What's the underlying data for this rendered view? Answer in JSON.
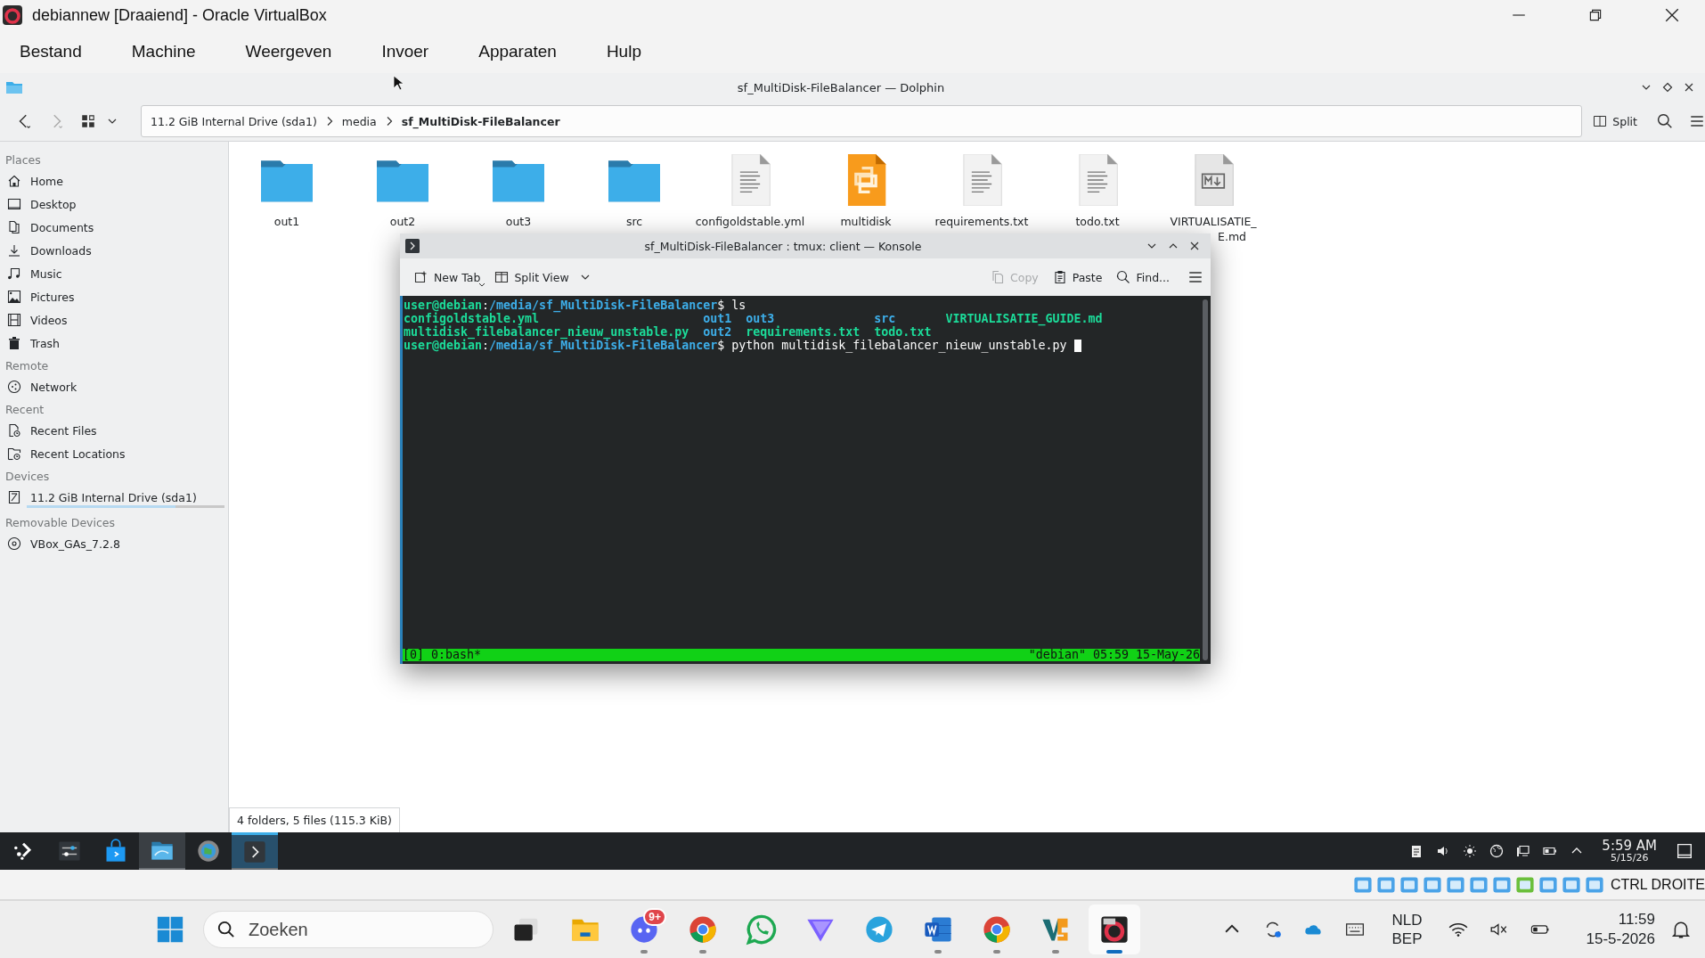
{
  "vbox": {
    "title": "debiannew [Draaiend] - Oracle VirtualBox",
    "menu": [
      "Bestand",
      "Machine",
      "Weergeven",
      "Invoer",
      "Apparaten",
      "Hulp"
    ],
    "host_key": "CTRL DROITE"
  },
  "dolphin": {
    "title": "sf_MultiDisk-FileBalancer — Dolphin",
    "breadcrumb": [
      {
        "label": "11.2 GiB Internal Drive (sda1)",
        "selected": false
      },
      {
        "label": "media",
        "selected": false
      },
      {
        "label": "sf_MultiDisk-FileBalancer",
        "selected": true
      }
    ],
    "split_label": "Split",
    "sidebar": [
      {
        "heading": "Places",
        "items": [
          {
            "label": "Home"
          },
          {
            "label": "Desktop"
          },
          {
            "label": "Documents"
          },
          {
            "label": "Downloads"
          },
          {
            "label": "Music"
          },
          {
            "label": "Pictures"
          },
          {
            "label": "Videos"
          },
          {
            "label": "Trash"
          }
        ]
      },
      {
        "heading": "Remote",
        "items": [
          {
            "label": "Network"
          }
        ]
      },
      {
        "heading": "Recent",
        "items": [
          {
            "label": "Recent Files"
          },
          {
            "label": "Recent Locations"
          }
        ]
      },
      {
        "heading": "Devices",
        "items": [
          {
            "label": "11.2 GiB Internal Drive (sda1)",
            "level": 0.75
          }
        ]
      },
      {
        "heading": "Removable Devices",
        "items": [
          {
            "label": "VBox_GAs_7.2.8"
          }
        ]
      }
    ],
    "files": [
      {
        "name": "out1",
        "kind": "folder"
      },
      {
        "name": "out2",
        "kind": "folder"
      },
      {
        "name": "out3",
        "kind": "folder"
      },
      {
        "name": "src",
        "kind": "folder"
      },
      {
        "name": "configoldstable.yml",
        "kind": "text"
      },
      {
        "name": "multidisk",
        "kind": "python"
      },
      {
        "name": "requirements.txt",
        "kind": "text"
      },
      {
        "name": "todo.txt",
        "kind": "text"
      },
      {
        "name": "VIRTUALISATIE_",
        "name_end": "E.md",
        "kind": "markdown"
      }
    ],
    "status": "4 folders, 5 files (115.3 KiB)"
  },
  "konsole": {
    "title": "sf_MultiDisk-FileBalancer : tmux: client — Konsole",
    "toolbar_left": [
      {
        "label": "New Tab"
      },
      {
        "label": "Split View"
      }
    ],
    "toolbar_right": [
      {
        "label": "Copy",
        "disabled": true
      },
      {
        "label": "Paste",
        "disabled": false
      },
      {
        "label": "Find...",
        "disabled": false
      }
    ],
    "lines": [
      {
        "kind": "prompt",
        "segments": [
          {
            "text": "user@debian",
            "kind": "prompt"
          },
          {
            "text": ":",
            "kind": "plain"
          },
          {
            "text": "/media/sf_MultiDisk-FileBalancer",
            "kind": "path"
          },
          {
            "text": "$ ls",
            "kind": "plain"
          }
        ]
      },
      {
        "kind": "listing",
        "segments": [
          {
            "text": "configoldstable.yml",
            "kind": "file"
          },
          {
            "text": "out1",
            "kind": "dir"
          },
          {
            "text": "out3",
            "kind": "dir"
          },
          {
            "text": "src",
            "kind": "dir"
          },
          {
            "text": "VIRTUALISATIE_GUIDE.md",
            "kind": "file"
          }
        ]
      },
      {
        "kind": "listing",
        "segments": [
          {
            "text": "multidisk_filebalancer_nieuw_unstable.py",
            "kind": "file"
          },
          {
            "text": "out2",
            "kind": "dir"
          },
          {
            "text": "requirements.txt",
            "kind": "file"
          },
          {
            "text": "todo.txt",
            "kind": "file"
          }
        ]
      },
      {
        "kind": "prompt",
        "segments": [
          {
            "text": "user@debian",
            "kind": "prompt"
          },
          {
            "text": ":",
            "kind": "plain"
          },
          {
            "text": "/media/sf_MultiDisk-FileBalancer",
            "kind": "path"
          },
          {
            "text": "$ python multidisk_filebalancer_nieuw_unstable.py",
            "kind": "plain"
          }
        ]
      }
    ],
    "cursor": true,
    "tmux_left": "[0] 0:bash*",
    "tmux_right": "\"debian\" 05:59 15-May-26"
  },
  "kde_panel": {
    "apps": [
      {
        "kind": "launcher",
        "open": false,
        "selected": false
      },
      {
        "kind": "mixer",
        "open": false,
        "selected": false
      },
      {
        "kind": "store",
        "open": false,
        "selected": false
      },
      {
        "kind": "files",
        "open": true,
        "selected": false
      },
      {
        "kind": "settings",
        "open": false,
        "selected": false
      },
      {
        "kind": "terminal",
        "open": true,
        "selected": true
      }
    ],
    "time": "5:59 AM",
    "date": "5/15/26"
  },
  "taskbar": {
    "search_placeholder": "Zoeken",
    "apps": [
      {
        "kind": "task-view",
        "running": false,
        "active": false
      },
      {
        "kind": "explorer",
        "running": false,
        "active": false
      },
      {
        "kind": "chat",
        "running": true,
        "active": false,
        "badge": "9+"
      },
      {
        "kind": "browser",
        "running": true,
        "active": false
      },
      {
        "kind": "phone-chat",
        "running": false,
        "active": false
      },
      {
        "kind": "vpn",
        "running": false,
        "active": false
      },
      {
        "kind": "messenger",
        "running": false,
        "active": false
      },
      {
        "kind": "word",
        "running": true,
        "active": false
      },
      {
        "kind": "browser",
        "running": true,
        "active": false
      },
      {
        "kind": "editor",
        "running": true,
        "active": false
      },
      {
        "kind": "vm",
        "running": true,
        "active": true
      }
    ],
    "lang": "NLD",
    "layout": "BEP",
    "time": "11:59",
    "date": "15-5-2026"
  }
}
